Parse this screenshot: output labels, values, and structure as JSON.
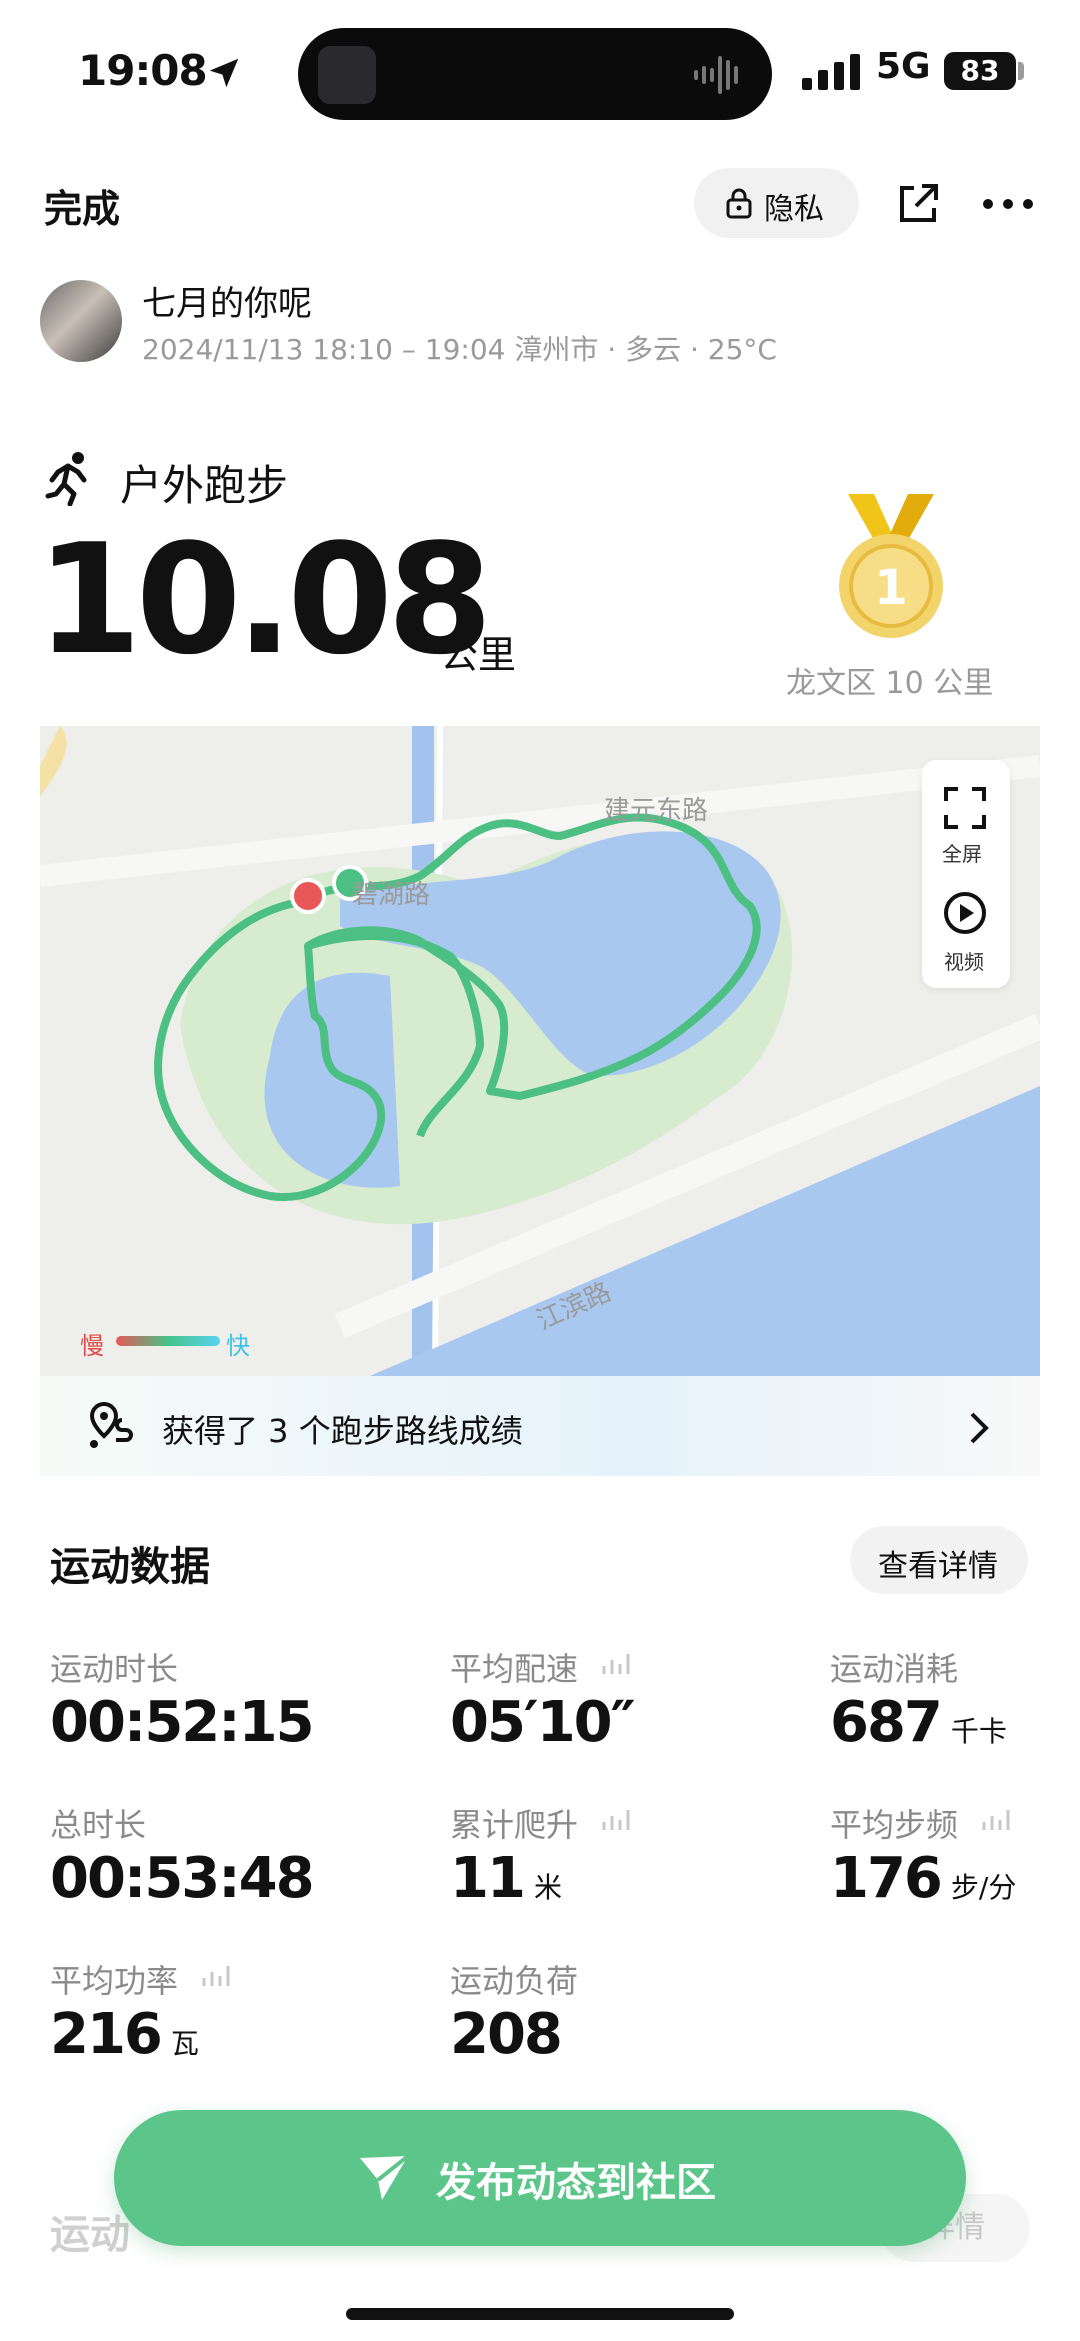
{
  "status_bar": {
    "time": "19:08",
    "network": "5G",
    "battery": "83"
  },
  "header": {
    "done": "完成",
    "privacy": "隐私"
  },
  "user": {
    "name": "七月的你呢",
    "meta": "2024/11/13 18:10 – 19:04 漳州市 · 多云 · 25°C"
  },
  "activity": {
    "type": "户外跑步",
    "distance": "10.08",
    "unit": "公里",
    "medal_number": "1",
    "medal_label": "龙文区 10 公里"
  },
  "map": {
    "roads": [
      "建元东路",
      "碧湖路",
      "江滨路"
    ],
    "fullscreen": "全屏",
    "video": "视频",
    "legend_slow": "慢",
    "legend_fast": "快",
    "route_color": "#4cbf82",
    "water_color": "#a9c8f0",
    "park_color": "#d7ebcf"
  },
  "banner": {
    "text": "获得了 3 个跑步路线成绩"
  },
  "stats": {
    "title": "运动数据",
    "detail_button": "查看详情",
    "items": [
      {
        "label": "运动时长",
        "value": "00:52:15",
        "unit": ""
      },
      {
        "label": "平均配速",
        "value": "05′10″",
        "unit": ""
      },
      {
        "label": "运动消耗",
        "value": "687",
        "unit": "千卡"
      },
      {
        "label": "总时长",
        "value": "00:53:48",
        "unit": ""
      },
      {
        "label": "累计爬升",
        "value": "11",
        "unit": "米"
      },
      {
        "label": "平均步频",
        "value": "176",
        "unit": "步/分"
      },
      {
        "label": "平均功率",
        "value": "216",
        "unit": "瓦"
      },
      {
        "label": "运动负荷",
        "value": "208",
        "unit": ""
      }
    ]
  },
  "under_section": {
    "title": "运动",
    "button": "详情"
  },
  "publish": {
    "label": "发布动态到社区"
  }
}
